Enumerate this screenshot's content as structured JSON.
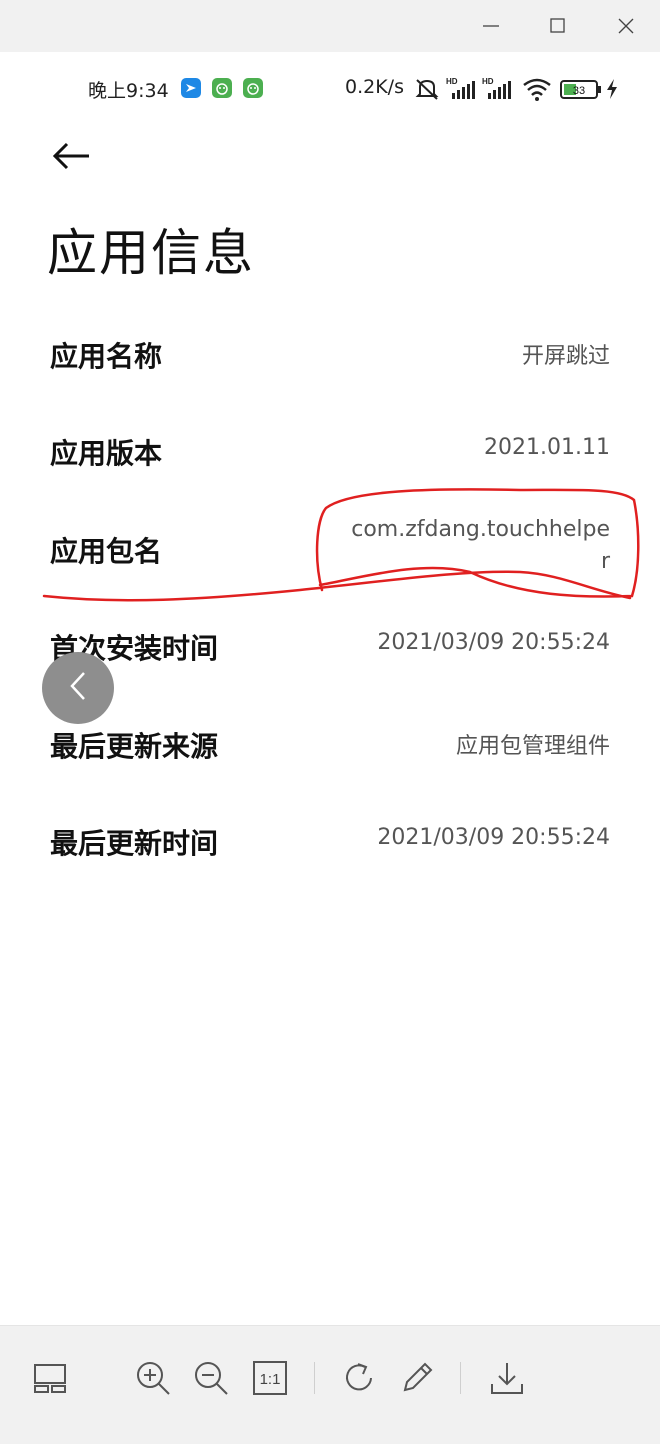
{
  "window": {
    "minimize_icon": "minimize-icon",
    "maximize_icon": "maximize-icon",
    "close_icon": "close-icon"
  },
  "status_bar": {
    "time": "晚上9:34",
    "network_speed": "0.2K/s",
    "battery": "33",
    "icons": [
      "feishu-icon",
      "app-green-icon",
      "app-green-icon",
      "mute-icon",
      "hd-signal-icon",
      "hd-signal-icon",
      "wifi-icon",
      "battery-icon",
      "charging-icon"
    ]
  },
  "page": {
    "back_icon": "back-arrow-icon",
    "title": "应用信息"
  },
  "info_rows": [
    {
      "label": "应用名称",
      "value": "开屏跳过"
    },
    {
      "label": "应用版本",
      "value": "2021.01.11"
    },
    {
      "label": "应用包名",
      "value": "com.zfdang.touchhelper"
    },
    {
      "label": "首次安装时间",
      "value": "2021/03/09 20:55:24"
    },
    {
      "label": "最后更新来源",
      "value": "应用包管理组件"
    },
    {
      "label": "最后更新时间",
      "value": "2021/03/09 20:55:24"
    }
  ],
  "annotation": {
    "color": "#e02020",
    "shape": "hand-drawn-circle-and-underline"
  },
  "floating_back_icon": "chevron-left-icon",
  "viewer_toolbar": {
    "items": [
      "thumbnail-layout-icon",
      "zoom-in-icon",
      "zoom-out-icon",
      "actual-size-icon",
      "rotate-icon",
      "edit-icon",
      "download-icon"
    ],
    "actual_size_label": "1:1"
  },
  "colors": {
    "chrome_bg": "#f1f1f1",
    "annotation": "#e02020",
    "value_text": "#555555"
  }
}
